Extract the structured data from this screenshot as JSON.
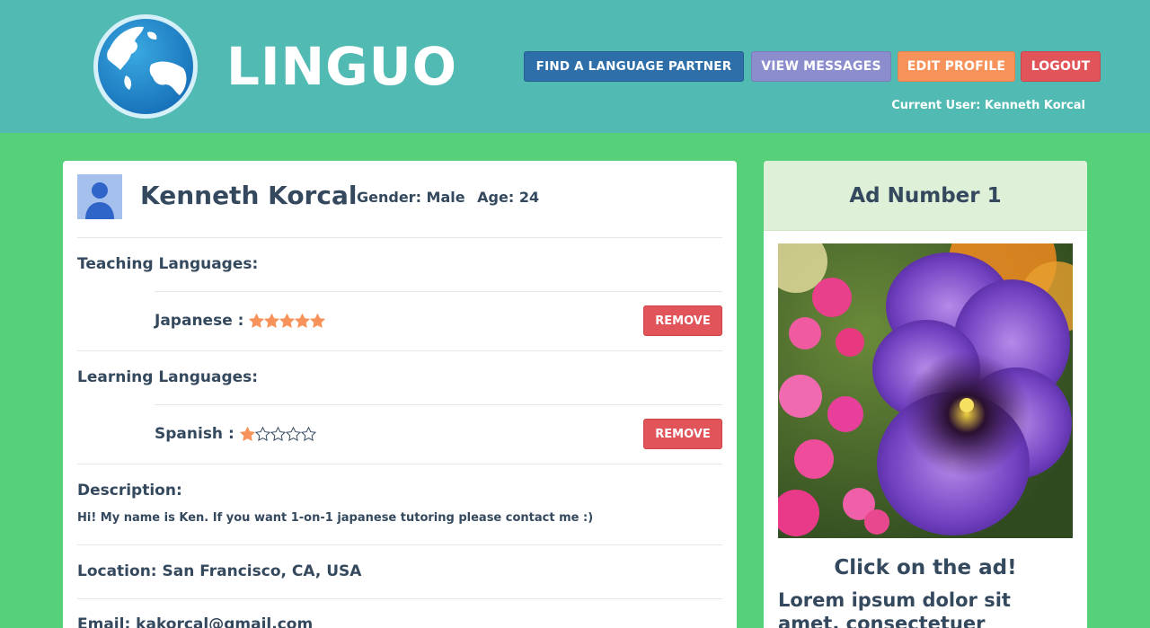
{
  "app": {
    "name": "LINGUO"
  },
  "nav": {
    "find_partner": "FIND A LANGUAGE PARTNER",
    "view_messages": "VIEW MESSAGES",
    "edit_profile": "EDIT PROFILE",
    "logout": "LOGOUT",
    "current_user": "Current User: Kenneth Korcal"
  },
  "profile": {
    "name": "Kenneth Korcal",
    "gender": "Gender: Male",
    "age": "Age: 24",
    "teaching_label": "Teaching Languages:",
    "teaching": [
      {
        "language": "Japanese :",
        "rating": 5,
        "max": 5,
        "action": "REMOVE"
      }
    ],
    "learning_label": "Learning Languages:",
    "learning": [
      {
        "language": "Spanish :",
        "rating": 1,
        "max": 5,
        "action": "REMOVE"
      }
    ],
    "description_label": "Description:",
    "description": "Hi! My name is Ken. If you want 1-on-1 japanese tutoring please contact me :)",
    "location": "Location: San Francisco, CA, USA",
    "email": "Email: kakorcal@gmail.com"
  },
  "ad": {
    "title": "Ad Number 1",
    "cta": "Click on the ad!",
    "body": "Lorem ipsum dolor sit amet, consectetuer adipiscing elit."
  },
  "colors": {
    "header_bg": "#50bab3",
    "page_bg": "#57d07a",
    "find_btn": "#2f6fa9",
    "messages_btn": "#8b8dcc",
    "edit_btn": "#f7935a",
    "logout_btn": "#e0545a",
    "star_filled": "#f7935a",
    "ad_header_bg": "#def0d8"
  },
  "icons": {
    "logo": "globe-icon",
    "avatar": "user-avatar-icon",
    "rating": "star-icon"
  }
}
